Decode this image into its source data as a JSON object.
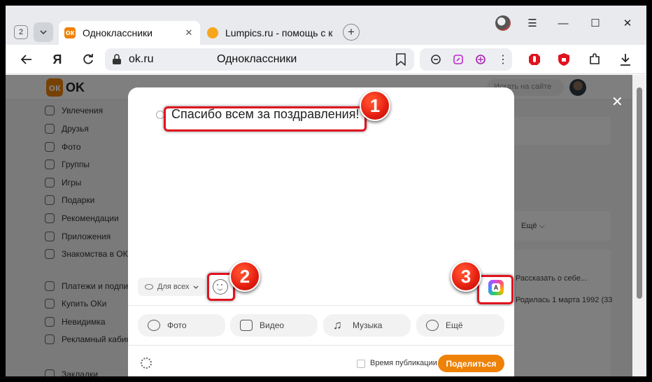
{
  "browser": {
    "tab_count": "2",
    "tabs": [
      {
        "title": "Одноклассники",
        "active": true
      },
      {
        "title": "Lumpics.ru - помощь с ко",
        "active": false
      }
    ],
    "address": {
      "url": "ok.ru",
      "page_title": "Одноклассники"
    },
    "window_controls": [
      "minimize",
      "maximize",
      "close"
    ]
  },
  "ok_page": {
    "logo_text": "OK",
    "search_placeholder": "Искать на сайте",
    "sidebar": [
      "Увлечения",
      "Друзья",
      "Фото",
      "Группы",
      "Игры",
      "Подарки",
      "Рекомендации",
      "Приложения",
      "Знакомства в ОК",
      "Платежи и подписки",
      "Купить ОКи",
      "Невидимка",
      "Рекламный кабинет",
      "Закладки"
    ],
    "background_text": {
      "more": "Ещё ⌵",
      "about": "Рассказать о себе...",
      "birthday": "Родилась 1 марта 1992 (33"
    }
  },
  "modal": {
    "post_text": "Спасибо всем за поздравления!",
    "audience": "Для всех",
    "attachments": [
      "Фото",
      "Видео",
      "Музыка",
      "Ещё"
    ],
    "schedule_label": "Время публикации",
    "share_button": "Поделиться"
  },
  "callouts": [
    "1",
    "2",
    "3"
  ],
  "colors": {
    "accent": "#ee8208",
    "highlight": "#e0131f"
  }
}
